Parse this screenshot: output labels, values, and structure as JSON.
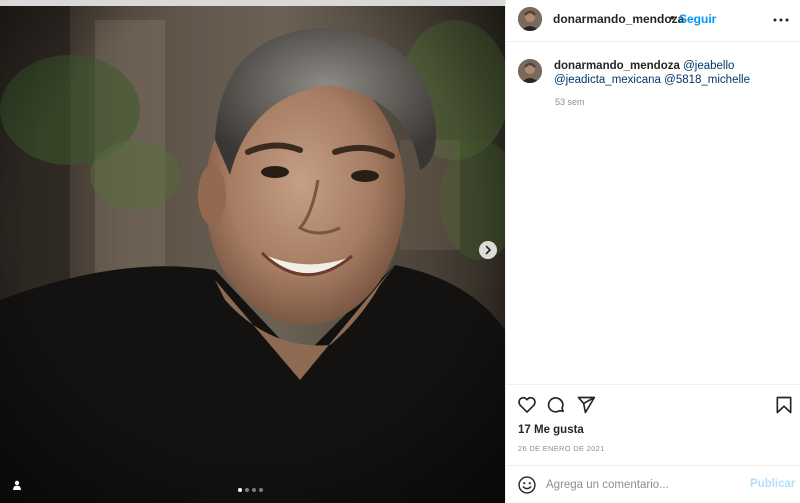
{
  "post": {
    "username": "donarmando_mendoza",
    "separator": "•",
    "follow_label": "Seguir",
    "more_icon": "more-horizontal-icon"
  },
  "caption": {
    "username": "donarmando_mendoza",
    "mentions": [
      "@jeabello",
      "@jeadicta_mexicana",
      "@5818_michelle"
    ],
    "time_ago": "53 sem"
  },
  "actions": {
    "icons": [
      "heart-icon",
      "comment-icon",
      "share-icon",
      "bookmark-icon"
    ]
  },
  "likes": {
    "label": "17 Me gusta"
  },
  "date": "26 DE ENERO DE 2021",
  "comment": {
    "placeholder": "Agrega un comentario...",
    "value": "",
    "submit_label": "Publicar"
  },
  "carousel": {
    "slide_count": 4,
    "active_index": 0
  },
  "colors": {
    "accent": "#0095f6",
    "submit_disabled": "#b2dffc",
    "mention": "#00376b",
    "muted": "#8e8e8e"
  }
}
